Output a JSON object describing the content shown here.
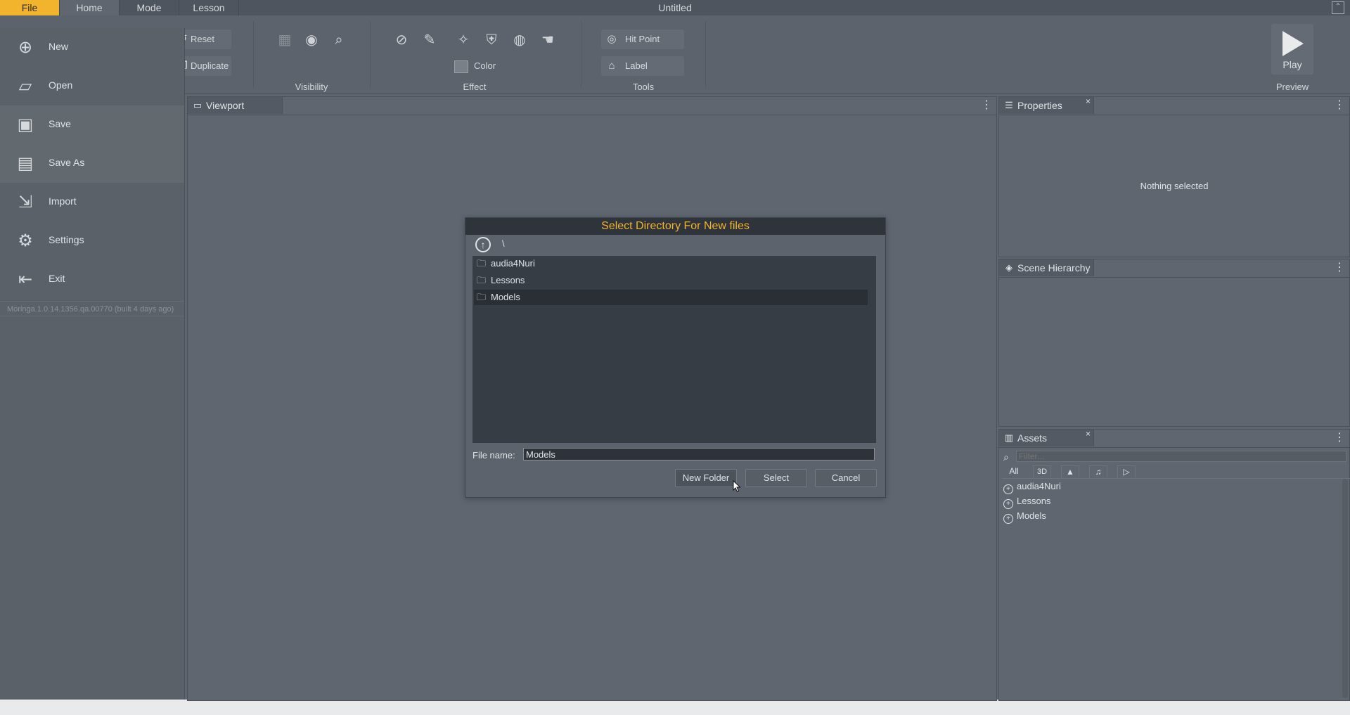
{
  "window": {
    "title": "Untitled",
    "tabs": {
      "file": "File",
      "home": "Home",
      "mode": "Mode",
      "lesson": "Lesson"
    },
    "maximize_glyph": "⌃"
  },
  "ribbon": {
    "reset": "Reset",
    "duplicate": "Duplicate",
    "visibility_group": "Visibility",
    "color": "Color",
    "effect_group": "Effect",
    "hit_point": "Hit Point",
    "label": "Label",
    "tools_group": "Tools",
    "play": "Play",
    "preview_group": "Preview"
  },
  "file_menu": {
    "items": [
      {
        "label": "New",
        "icon": "new-file-icon"
      },
      {
        "label": "Open",
        "icon": "folder-open-icon"
      },
      {
        "label": "Save",
        "icon": "save-icon"
      },
      {
        "label": "Save As",
        "icon": "save-as-icon"
      },
      {
        "label": "Import",
        "icon": "import-icon"
      },
      {
        "label": "Settings",
        "icon": "gear-icon"
      },
      {
        "label": "Exit",
        "icon": "exit-icon"
      }
    ],
    "version": "Moringa.1.0.14.1356.qa.00770 (built 4 days ago)"
  },
  "viewport": {
    "tab": "Viewport"
  },
  "properties": {
    "tab": "Properties",
    "empty": "Nothing selected"
  },
  "scene_hierarchy": {
    "tab": "Scene Hierarchy"
  },
  "assets": {
    "tab": "Assets",
    "filter_placeholder": "Filter...",
    "filter_tabs": {
      "all": "All",
      "three_d": "3D"
    },
    "items": [
      "audia4Nuri",
      "Lessons",
      "Models"
    ]
  },
  "dialog": {
    "title": "Select Directory For New files",
    "path": "\\",
    "folders": [
      "audia4Nuri",
      "Lessons",
      "Models"
    ],
    "selected_folder": "Models",
    "file_name_label": "File name:",
    "file_name_value": "Models",
    "new_folder": "New Folder",
    "select": "Select",
    "cancel": "Cancel"
  }
}
